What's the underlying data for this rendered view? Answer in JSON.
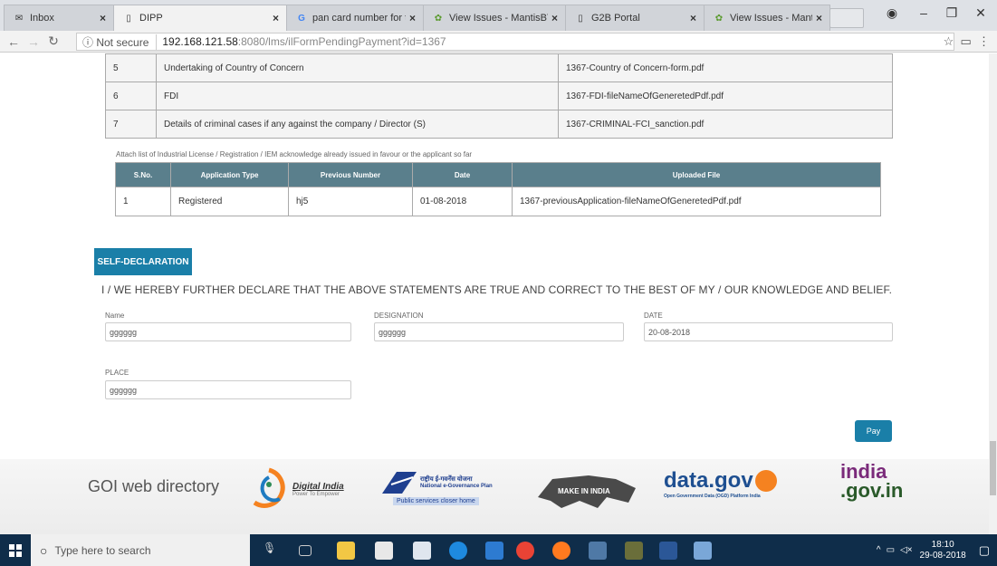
{
  "browser": {
    "tabs": [
      {
        "label": "Inbox",
        "icon": "mail-icon"
      },
      {
        "label": "DIPP",
        "icon": "page-icon"
      },
      {
        "label": "pan card number for te",
        "icon": "google-icon"
      },
      {
        "label": "View Issues - MantisBT",
        "icon": "mantis-icon"
      },
      {
        "label": "G2B Portal",
        "icon": "page-icon"
      },
      {
        "label": "View Issues - MantisBT",
        "icon": "mantis-icon"
      }
    ],
    "security": "Not secure",
    "url_host": "192.168.121.58",
    "url_rest": ":8080/lms/ilFormPendingPayment?id=1367"
  },
  "docs_table": {
    "rows": [
      {
        "sno": "5",
        "name": "Undertaking of Country of Concern",
        "file": "1367-Country of Concern-form.pdf"
      },
      {
        "sno": "6",
        "name": "FDI",
        "file": "1367-FDI-fileNameOfGeneretedPdf.pdf"
      },
      {
        "sno": "7",
        "name": "Details of criminal cases if any against the company / Director (S)",
        "file": "1367-CRIMINAL-FCI_sanction.pdf"
      }
    ]
  },
  "prev_apps": {
    "label": "Attach list of Industrial License / Registration / IEM acknowledge already issued in favour or the applicant so far",
    "headers": [
      "S.No.",
      "Application Type",
      "Previous Number",
      "Date",
      "Uploaded File"
    ],
    "rows": [
      [
        "1",
        "Registered",
        "hj5",
        "01-08-2018",
        "1367-previousApplication-fileNameOfGeneretedPdf.pdf"
      ]
    ]
  },
  "declaration": {
    "section_label": "SELF-DECLARATION",
    "statement": "I / WE HEREBY FURTHER DECLARE THAT THE ABOVE STATEMENTS ARE TRUE AND CORRECT TO THE BEST OF MY / OUR KNOWLEDGE AND BELIEF.",
    "name_label": "Name",
    "name_value": "gggggg",
    "designation_label": "DESIGNATION",
    "designation_value": "gggggg",
    "date_label": "DATE",
    "date_value": "20-08-2018",
    "place_label": "PLACE",
    "place_value": "gggggg",
    "pay_label": "Pay"
  },
  "footer": {
    "goi": "GOI web directory",
    "digital_india": "Digital India",
    "digital_india_sub": "Power To Empower",
    "negp_hindi": "राष्ट्रीय ई-गवर्नेंस योजना",
    "negp": "National e-Governance Plan",
    "negp_tag": "Public services closer home",
    "make_in_india": "MAKE IN INDIA",
    "datagov": "data.gov",
    "datagov_sub": "Open Government Data (OGD) Platform India",
    "india": "india",
    "india_gov": ".gov.in"
  },
  "taskbar": {
    "search_placeholder": "Type here to search",
    "time": "18:10",
    "date": "29-08-2018"
  },
  "colors": {
    "accent": "#1a7fa8",
    "table_header": "#5a7f8c",
    "taskbar": "#0f2d4a"
  }
}
